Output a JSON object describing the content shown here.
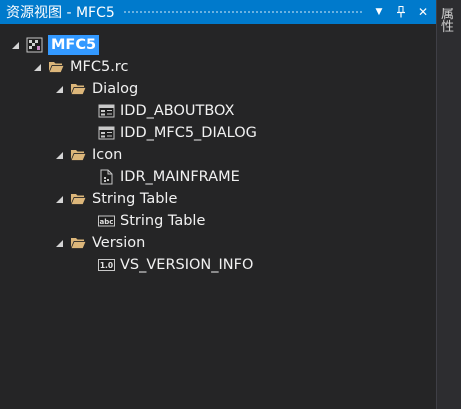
{
  "panel": {
    "title": "资源视图 - MFC5",
    "dropdown_glyph": "▼",
    "pin_glyph": "⊥",
    "close_glyph": "✕"
  },
  "side_strip": {
    "tab_label": "属性"
  },
  "tree": {
    "root": {
      "label": "MFC5",
      "icon": "project-icon",
      "expanded": true,
      "selected": true
    },
    "rc": {
      "label": "MFC5.rc",
      "icon": "folder-open-icon",
      "expanded": true
    },
    "folders": [
      {
        "label": "Dialog",
        "icon": "folder-open-icon",
        "expanded": true,
        "children": [
          {
            "label": "IDD_ABOUTBOX",
            "icon": "dialog-icon"
          },
          {
            "label": "IDD_MFC5_DIALOG",
            "icon": "dialog-icon"
          }
        ]
      },
      {
        "label": "Icon",
        "icon": "folder-open-icon",
        "expanded": true,
        "children": [
          {
            "label": "IDR_MAINFRAME",
            "icon": "icon-file-icon"
          }
        ]
      },
      {
        "label": "String Table",
        "icon": "folder-open-icon",
        "expanded": true,
        "children": [
          {
            "label": "String Table",
            "icon": "string-table-icon",
            "icon_text": "abc"
          }
        ]
      },
      {
        "label": "Version",
        "icon": "folder-open-icon",
        "expanded": true,
        "children": [
          {
            "label": "VS_VERSION_INFO",
            "icon": "version-icon",
            "icon_text": "1.0"
          }
        ]
      }
    ]
  },
  "colors": {
    "title_bar": "#007acc",
    "background": "#252526",
    "selection": "#3399ff",
    "folder": "#dcb67a",
    "text": "#f1f1f1"
  }
}
